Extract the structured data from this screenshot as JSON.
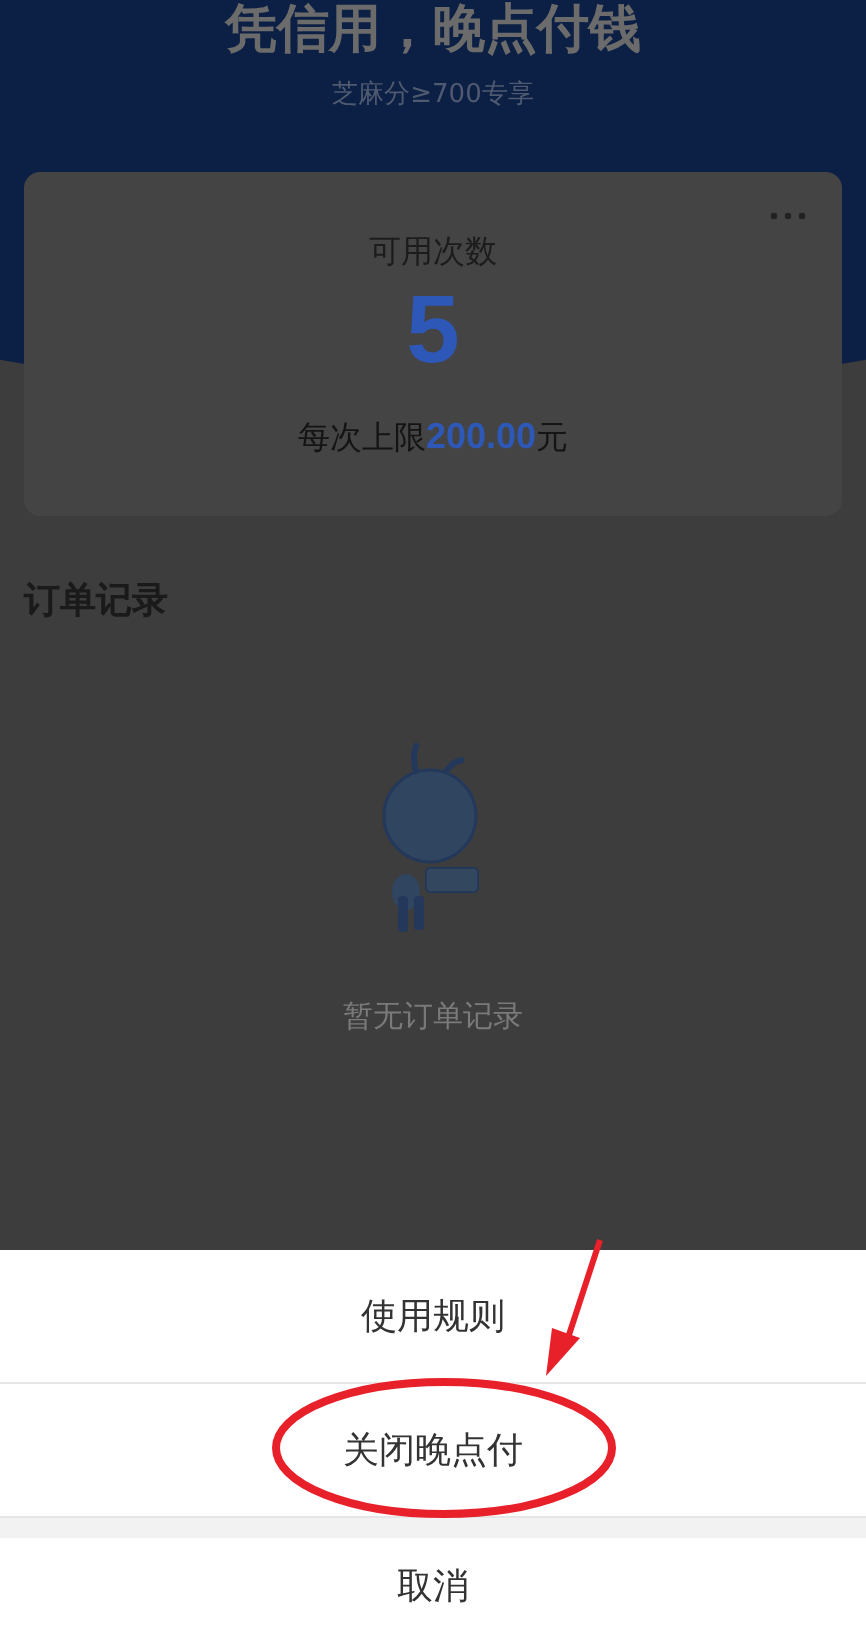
{
  "header": {
    "title": "凭信用，晚点付钱",
    "subtitle": "芝麻分≥700专享"
  },
  "card": {
    "label": "可用次数",
    "count": "5",
    "limit": "每次上限**200.00**元"
  },
  "orders": {
    "title": "订单记录",
    "empty_text": "暂无订单记录"
  },
  "action_sheet": {
    "items": [
      {
        "label": "使用规则"
      },
      {
        "label": "关闭晚点付"
      }
    ],
    "cancel": "取消"
  }
}
